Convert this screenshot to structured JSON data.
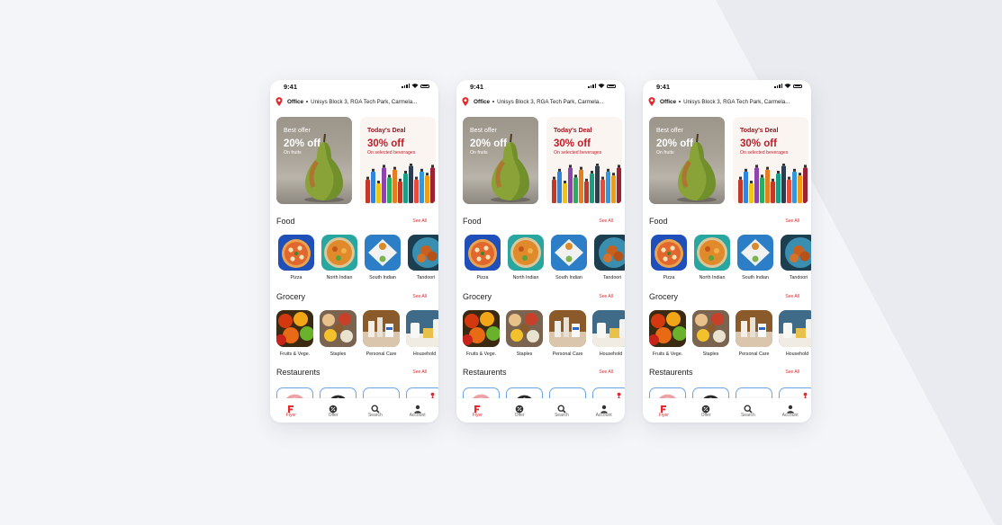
{
  "colors": {
    "accent": "#e32a2f",
    "deal_red": "#c01c28",
    "background": "#f4f5f8",
    "restaurant_border": "#6aa6e6"
  },
  "phones": [
    {
      "time": "9:41",
      "location": {
        "name": "Office",
        "address": "Unisys Block 3, RGA Tech Park, Carmela..."
      },
      "offers": [
        {
          "tag": "Best offer",
          "value": "20% off",
          "sub": "On fruits",
          "image": "pear"
        },
        {
          "tag": "Today's Deal",
          "value": "30% off",
          "sub": "On selected beverages",
          "image": "bottles"
        }
      ],
      "sections": {
        "food": {
          "title": "Food",
          "see_all": "See All",
          "items": [
            "Pizza",
            "North Indian",
            "South Indian",
            "Tandoori"
          ]
        },
        "grocery": {
          "title": "Grocery",
          "see_all": "See All",
          "items": [
            "Fruits & Vege.",
            "Staples",
            "Personal Care",
            "Household"
          ]
        },
        "restaurants": {
          "title": "Restaurents",
          "see_all": "See All"
        }
      },
      "tabs": [
        {
          "label": "Flyer",
          "icon": "flyer-logo-icon",
          "active": true
        },
        {
          "label": "Offer",
          "icon": "offer-badge-icon",
          "active": false
        },
        {
          "label": "Search",
          "icon": "search-icon",
          "active": false
        },
        {
          "label": "Account",
          "icon": "account-icon",
          "active": false
        }
      ]
    },
    {
      "time": "9:41",
      "location": {
        "name": "Office",
        "address": "Unisys Block 3, RGA Tech Park, Carmela..."
      },
      "offers": [
        {
          "tag": "Best offer",
          "value": "20% off",
          "sub": "On fruits",
          "image": "pear"
        },
        {
          "tag": "Today's Deal",
          "value": "30% off",
          "sub": "On selected beverages",
          "image": "bottles"
        }
      ],
      "sections": {
        "food": {
          "title": "Food",
          "see_all": "See All",
          "items": [
            "Pizza",
            "North Indian",
            "South Indian",
            "Tandoori"
          ]
        },
        "grocery": {
          "title": "Grocery",
          "see_all": "See All",
          "items": [
            "Fruits & Vege.",
            "Staples",
            "Personal Care",
            "Household"
          ]
        },
        "restaurants": {
          "title": "Restaurents",
          "see_all": "See All"
        }
      },
      "tabs": [
        {
          "label": "Flyer",
          "icon": "flyer-logo-icon",
          "active": true
        },
        {
          "label": "Offer",
          "icon": "offer-badge-icon",
          "active": false
        },
        {
          "label": "Search",
          "icon": "search-icon",
          "active": false
        },
        {
          "label": "Account",
          "icon": "account-icon",
          "active": false
        }
      ]
    },
    {
      "time": "9:41",
      "location": {
        "name": "Office",
        "address": "Unisys Block 3, RGA Tech Park, Carmela..."
      },
      "offers": [
        {
          "tag": "Best offer",
          "value": "20% off",
          "sub": "On fruits",
          "image": "pear"
        },
        {
          "tag": "Today's Deal",
          "value": "30% off",
          "sub": "On selected beverages",
          "image": "bottles"
        }
      ],
      "sections": {
        "food": {
          "title": "Food",
          "see_all": "See All",
          "items": [
            "Pizza",
            "North Indian",
            "South Indian",
            "Tandoori"
          ]
        },
        "grocery": {
          "title": "Grocery",
          "see_all": "See All",
          "items": [
            "Fruits & Vege.",
            "Staples",
            "Personal Care",
            "Household"
          ]
        },
        "restaurants": {
          "title": "Restaurents",
          "see_all": "See All"
        }
      },
      "tabs": [
        {
          "label": "Flyer",
          "icon": "flyer-logo-icon",
          "active": true
        },
        {
          "label": "Offer",
          "icon": "offer-badge-icon",
          "active": false
        },
        {
          "label": "Search",
          "icon": "search-icon",
          "active": false
        },
        {
          "label": "Account",
          "icon": "account-icon",
          "active": false
        }
      ]
    }
  ]
}
